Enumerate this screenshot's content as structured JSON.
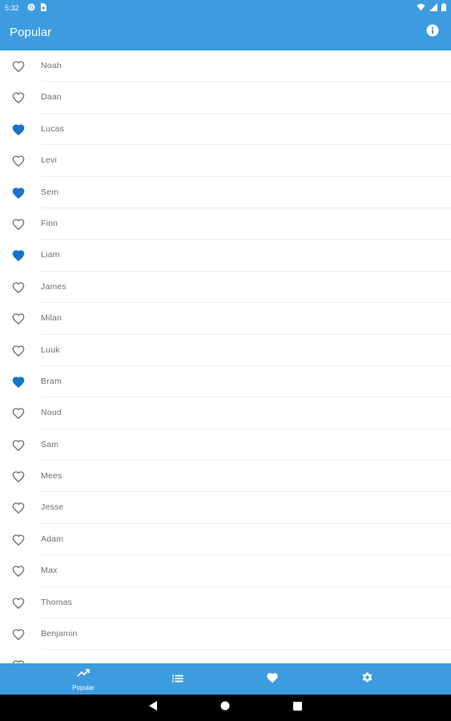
{
  "status_bar": {
    "time": "5:32",
    "left_icons": [
      "notification-icon",
      "sim-icon"
    ],
    "right_icons": [
      "wifi-icon",
      "signal-icon",
      "battery-icon"
    ]
  },
  "app_bar": {
    "title": "Popular",
    "action_icon": "info-icon"
  },
  "colors": {
    "primary": "#3d9ce0",
    "heart_filled": "#1a73c8",
    "heart_outline": "#6e6e6e",
    "text": "#6e6e6e"
  },
  "list": {
    "items": [
      {
        "name": "Noah",
        "favorite": false
      },
      {
        "name": "Daan",
        "favorite": false
      },
      {
        "name": "Lucas",
        "favorite": true
      },
      {
        "name": "Levi",
        "favorite": false
      },
      {
        "name": "Sem",
        "favorite": true
      },
      {
        "name": "Finn",
        "favorite": false
      },
      {
        "name": "Liam",
        "favorite": true
      },
      {
        "name": "James",
        "favorite": false
      },
      {
        "name": "Milan",
        "favorite": false
      },
      {
        "name": "Luuk",
        "favorite": false
      },
      {
        "name": "Bram",
        "favorite": true
      },
      {
        "name": "Noud",
        "favorite": false
      },
      {
        "name": "Sam",
        "favorite": false
      },
      {
        "name": "Mees",
        "favorite": false
      },
      {
        "name": "Jesse",
        "favorite": false
      },
      {
        "name": "Adam",
        "favorite": false
      },
      {
        "name": "Max",
        "favorite": false
      },
      {
        "name": "Thomas",
        "favorite": false
      },
      {
        "name": "Benjamin",
        "favorite": false
      },
      {
        "name": "",
        "favorite": false
      }
    ]
  },
  "bottom_nav": {
    "tabs": [
      {
        "label": "Popular",
        "icon": "trending-up-icon",
        "active": true
      },
      {
        "label": "",
        "icon": "list-icon",
        "active": false
      },
      {
        "label": "",
        "icon": "heart-icon",
        "active": false
      },
      {
        "label": "",
        "icon": "gear-icon",
        "active": false
      }
    ]
  },
  "system_nav": {
    "buttons": [
      "back-icon",
      "home-icon",
      "recents-icon"
    ]
  }
}
